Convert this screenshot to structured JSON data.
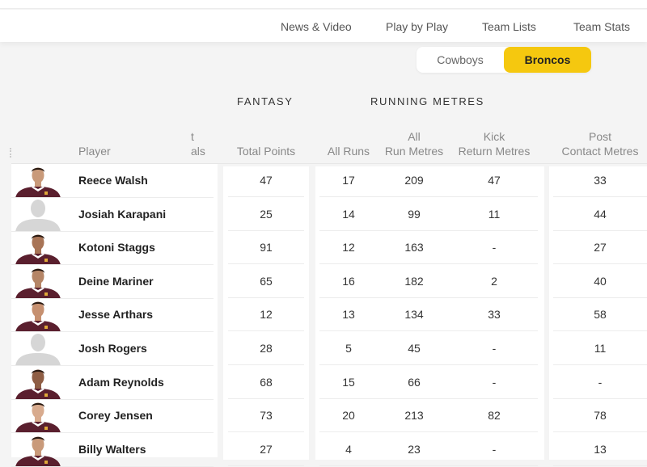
{
  "nav": {
    "items": [
      "News & Video",
      "Play by Play",
      "Team Lists",
      "Team Stats"
    ]
  },
  "team_toggle": {
    "options": [
      "Cowboys",
      "Broncos"
    ],
    "selected": "Broncos",
    "accent_color": "#f5c80f"
  },
  "groups": {
    "fantasy": "FANTASY",
    "running_metres": "RUNNING METRES"
  },
  "headers": {
    "player": "Player",
    "partial_top": "t",
    "partial_bottom": "als",
    "total_points": "Total Points",
    "all_runs": "All Runs",
    "all_run_metres_1": "All",
    "all_run_metres_2": "Run Metres",
    "kick_return_1": "Kick",
    "kick_return_2": "Return Metres",
    "post_contact_1": "Post",
    "post_contact_2": "Contact Metres"
  },
  "players": [
    {
      "name": "Reece Walsh",
      "photo": "player-photo",
      "total_points": "47",
      "all_runs": "17",
      "all_run_metres": "209",
      "kick_return_metres": "47",
      "post_contact_metres": "33"
    },
    {
      "name": "Josiah Karapani",
      "photo": "placeholder-silhouette",
      "total_points": "25",
      "all_runs": "14",
      "all_run_metres": "99",
      "kick_return_metres": "11",
      "post_contact_metres": "44"
    },
    {
      "name": "Kotoni Staggs",
      "photo": "player-photo",
      "total_points": "91",
      "all_runs": "12",
      "all_run_metres": "163",
      "kick_return_metres": "-",
      "post_contact_metres": "27"
    },
    {
      "name": "Deine Mariner",
      "photo": "player-photo",
      "total_points": "65",
      "all_runs": "16",
      "all_run_metres": "182",
      "kick_return_metres": "2",
      "post_contact_metres": "40"
    },
    {
      "name": "Jesse Arthars",
      "photo": "player-photo",
      "total_points": "12",
      "all_runs": "13",
      "all_run_metres": "134",
      "kick_return_metres": "33",
      "post_contact_metres": "58"
    },
    {
      "name": "Josh Rogers",
      "photo": "placeholder-silhouette",
      "total_points": "28",
      "all_runs": "5",
      "all_run_metres": "45",
      "kick_return_metres": "-",
      "post_contact_metres": "11"
    },
    {
      "name": "Adam Reynolds",
      "photo": "player-photo",
      "total_points": "68",
      "all_runs": "15",
      "all_run_metres": "66",
      "kick_return_metres": "-",
      "post_contact_metres": "-"
    },
    {
      "name": "Corey Jensen",
      "photo": "player-photo",
      "total_points": "73",
      "all_runs": "20",
      "all_run_metres": "213",
      "kick_return_metres": "82",
      "post_contact_metres": "78"
    },
    {
      "name": "Billy Walters",
      "photo": "player-photo",
      "total_points": "27",
      "all_runs": "4",
      "all_run_metres": "23",
      "kick_return_metres": "-",
      "post_contact_metres": "13"
    }
  ]
}
